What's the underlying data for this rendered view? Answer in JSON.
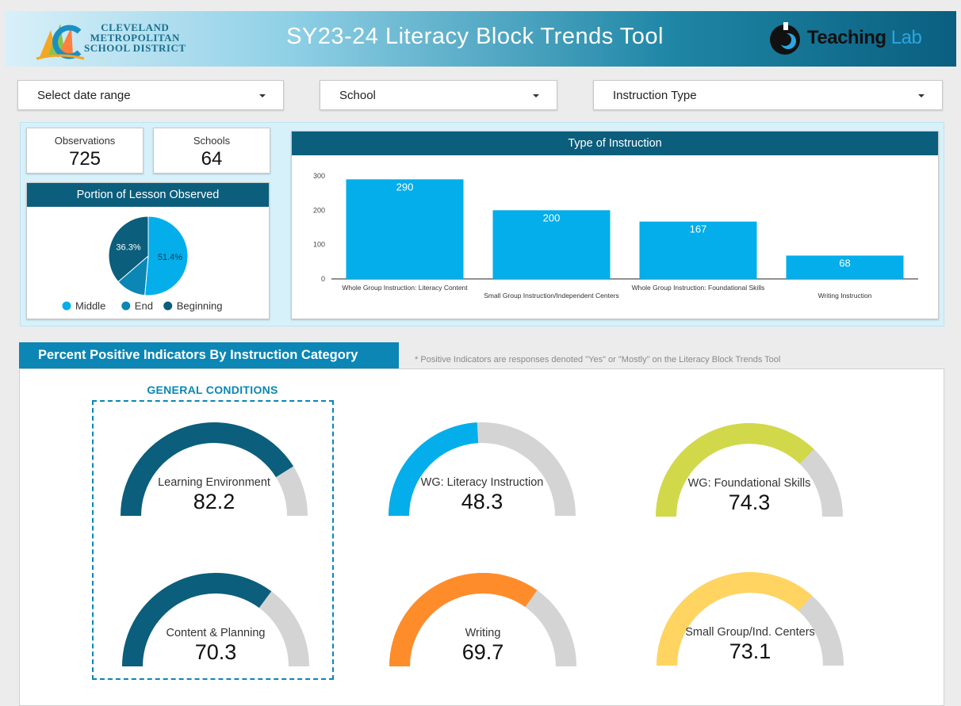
{
  "header": {
    "title": "SY23-24 Literacy Block Trends Tool",
    "logo_left_lines": [
      "CLEVELAND",
      "METROPOLITAN",
      "SCHOOL DISTRICT"
    ],
    "logo_right_main": "Teaching",
    "logo_right_accent": "Lab"
  },
  "filters": [
    {
      "label": "Select date range"
    },
    {
      "label": "School"
    },
    {
      "label": "Instruction Type"
    }
  ],
  "kpis": {
    "observations": {
      "label": "Observations",
      "value": "725"
    },
    "schools": {
      "label": "Schools",
      "value": "64"
    }
  },
  "bottom": {
    "section_title": "Percent Positive Indicators By Instruction Category",
    "note": "* Positive Indicators are responses denoted \"Yes\" or \"Mostly\" on the Literacy Block Trends Tool",
    "group_label": "GENERAL CONDITIONS"
  },
  "colors": {
    "accent_dark": "#0b5e7c",
    "bar_blue": "#03aeea",
    "gauge_track": "#d4d4d4"
  },
  "chart_data": [
    {
      "type": "pie",
      "title": "Portion of Lesson Observed",
      "slices": [
        {
          "label": "Middle",
          "value": 51.4,
          "color": "#03aeea"
        },
        {
          "label": "End",
          "value": 12.3,
          "color": "#0b86b5"
        },
        {
          "label": "Beginning",
          "value": 36.3,
          "color": "#0b5e7c"
        }
      ],
      "data_labels": [
        "51.4%",
        "",
        "36.3%"
      ],
      "legend": "bottom"
    },
    {
      "type": "bar",
      "title": "Type of Instruction",
      "categories": [
        "Whole Group Instruction: Literacy Content",
        "Small Group Instruction/Independent Centers",
        "Whole Group Instruction: Foundational Skills",
        "Writing Instruction"
      ],
      "values": [
        290,
        200,
        167,
        68
      ],
      "ylim": [
        0,
        300
      ],
      "yticks": [
        0,
        100,
        200,
        300
      ],
      "color": "#03aeea",
      "grid": false
    },
    {
      "type": "gauge",
      "gauges": [
        {
          "label": "Learning Environment",
          "value": 82.2,
          "color": "#0b5e7c"
        },
        {
          "label": "WG: Literacy Instruction",
          "value": 48.3,
          "color": "#03aeea"
        },
        {
          "label": "WG: Foundational Skills",
          "value": 74.3,
          "color": "#d1d94a"
        },
        {
          "label": "Content & Planning",
          "value": 70.3,
          "color": "#0b5e7c"
        },
        {
          "label": "Writing",
          "value": 69.7,
          "color": "#ff8c2a"
        },
        {
          "label": "Small Group/Ind. Centers",
          "value": 73.1,
          "color": "#ffd460"
        }
      ],
      "range": [
        0,
        100
      ]
    }
  ]
}
